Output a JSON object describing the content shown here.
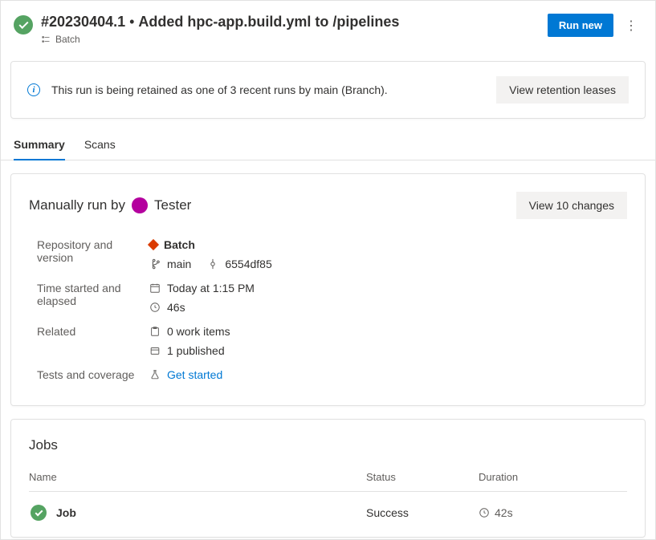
{
  "header": {
    "build_id": "#20230404.1",
    "separator": " • ",
    "title": "Added hpc-app.build.yml to /pipelines",
    "pipeline_name": "Batch",
    "run_new_label": "Run new",
    "more_label": "⋮"
  },
  "banner": {
    "text": "This run is being retained as one of 3 recent runs by main (Branch).",
    "button_label": "View retention leases"
  },
  "tabs": {
    "summary": "Summary",
    "scans": "Scans"
  },
  "summary": {
    "run_by_prefix": "Manually run by",
    "run_by_user": "Tester",
    "view_changes_label": "View 10 changes",
    "props": {
      "repo_label": "Repository and version",
      "repo_name": "Batch",
      "branch": "main",
      "commit": "6554df85",
      "time_label": "Time started and elapsed",
      "started": "Today at 1:15 PM",
      "elapsed": "46s",
      "related_label": "Related",
      "work_items": "0 work items",
      "published": "1 published",
      "tests_label": "Tests and coverage",
      "tests_link": "Get started"
    }
  },
  "jobs": {
    "title": "Jobs",
    "cols": {
      "name": "Name",
      "status": "Status",
      "duration": "Duration"
    },
    "row": {
      "name": "Job",
      "status": "Success",
      "duration": "42s"
    }
  }
}
